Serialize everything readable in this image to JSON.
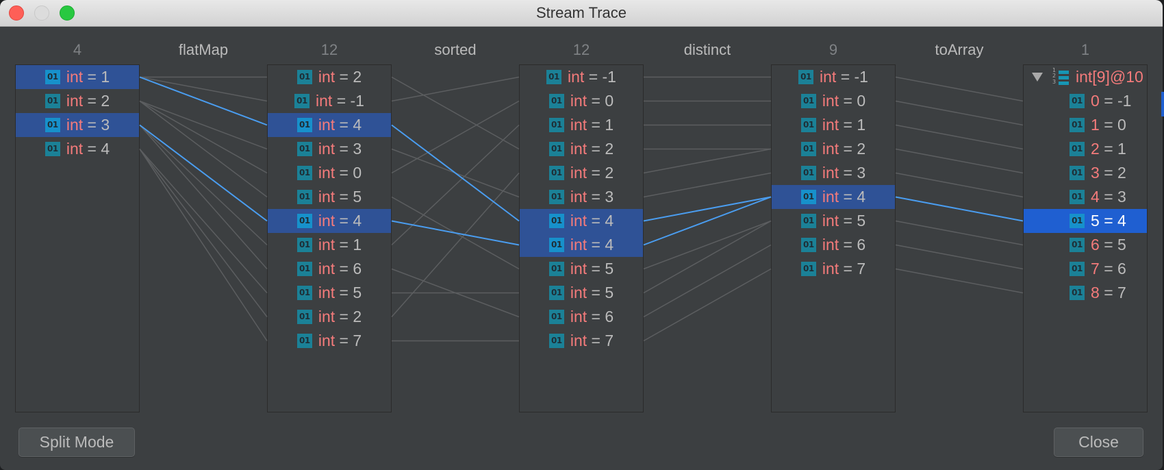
{
  "window": {
    "title": "Stream Trace"
  },
  "colors": {
    "selected_row": "#2f5296",
    "selected_row_focused": "#1f5fd1",
    "link_default": "#5c5e60",
    "link_selected": "#4a9df0",
    "name_text": "#f47b7b",
    "value_text": "#bbbbbb"
  },
  "stages": [
    {
      "count": "4"
    },
    {
      "count": "12"
    },
    {
      "count": "12"
    },
    {
      "count": "9"
    },
    {
      "count": "1"
    }
  ],
  "operations": [
    "flatMap",
    "sorted",
    "distinct",
    "toArray"
  ],
  "columns": [
    {
      "items": [
        {
          "name": "int",
          "value": "= 1",
          "selected": true
        },
        {
          "name": "int",
          "value": "= 2",
          "selected": false
        },
        {
          "name": "int",
          "value": "= 3",
          "selected": true
        },
        {
          "name": "int",
          "value": "= 4",
          "selected": false
        }
      ]
    },
    {
      "items": [
        {
          "name": "int",
          "value": "= 2",
          "selected": false
        },
        {
          "name": "int",
          "value": "= -1",
          "selected": false
        },
        {
          "name": "int",
          "value": "= 4",
          "selected": true
        },
        {
          "name": "int",
          "value": "= 3",
          "selected": false
        },
        {
          "name": "int",
          "value": "= 0",
          "selected": false
        },
        {
          "name": "int",
          "value": "= 5",
          "selected": false
        },
        {
          "name": "int",
          "value": "= 4",
          "selected": true
        },
        {
          "name": "int",
          "value": "= 1",
          "selected": false
        },
        {
          "name": "int",
          "value": "= 6",
          "selected": false
        },
        {
          "name": "int",
          "value": "= 5",
          "selected": false
        },
        {
          "name": "int",
          "value": "= 2",
          "selected": false
        },
        {
          "name": "int",
          "value": "= 7",
          "selected": false
        }
      ]
    },
    {
      "items": [
        {
          "name": "int",
          "value": "= -1",
          "selected": false
        },
        {
          "name": "int",
          "value": "= 0",
          "selected": false
        },
        {
          "name": "int",
          "value": "= 1",
          "selected": false
        },
        {
          "name": "int",
          "value": "= 2",
          "selected": false
        },
        {
          "name": "int",
          "value": "= 2",
          "selected": false
        },
        {
          "name": "int",
          "value": "= 3",
          "selected": false
        },
        {
          "name": "int",
          "value": "= 4",
          "selected": true
        },
        {
          "name": "int",
          "value": "= 4",
          "selected": true
        },
        {
          "name": "int",
          "value": "= 5",
          "selected": false
        },
        {
          "name": "int",
          "value": "= 5",
          "selected": false
        },
        {
          "name": "int",
          "value": "= 6",
          "selected": false
        },
        {
          "name": "int",
          "value": "= 7",
          "selected": false
        }
      ]
    },
    {
      "items": [
        {
          "name": "int",
          "value": "= -1",
          "selected": false
        },
        {
          "name": "int",
          "value": "= 0",
          "selected": false
        },
        {
          "name": "int",
          "value": "= 1",
          "selected": false
        },
        {
          "name": "int",
          "value": "= 2",
          "selected": false
        },
        {
          "name": "int",
          "value": "= 3",
          "selected": false
        },
        {
          "name": "int",
          "value": "= 4",
          "selected": true
        },
        {
          "name": "int",
          "value": "= 5",
          "selected": false
        },
        {
          "name": "int",
          "value": "= 6",
          "selected": false
        },
        {
          "name": "int",
          "value": "= 7",
          "selected": false
        }
      ]
    }
  ],
  "result": {
    "label": "int[9]@10",
    "expanded": true,
    "array_icon_digits": [
      "1",
      "2",
      "3"
    ],
    "items": [
      {
        "name": "0",
        "value": "= -1",
        "selected": false
      },
      {
        "name": "1",
        "value": "= 0",
        "selected": false
      },
      {
        "name": "2",
        "value": "= 1",
        "selected": false
      },
      {
        "name": "3",
        "value": "= 2",
        "selected": false
      },
      {
        "name": "4",
        "value": "= 3",
        "selected": false
      },
      {
        "name": "5",
        "value": "= 4",
        "selected": true
      },
      {
        "name": "6",
        "value": "= 5",
        "selected": false
      },
      {
        "name": "7",
        "value": "= 6",
        "selected": false
      },
      {
        "name": "8",
        "value": "= 7",
        "selected": false
      }
    ]
  },
  "links": [
    [
      [
        0,
        0
      ],
      [
        0,
        1
      ],
      [
        0,
        2
      ],
      [
        1,
        3
      ],
      [
        1,
        4
      ],
      [
        1,
        5
      ],
      [
        2,
        6
      ],
      [
        2,
        7
      ],
      [
        2,
        8
      ],
      [
        3,
        9
      ],
      [
        3,
        10
      ],
      [
        3,
        11
      ]
    ],
    [
      [
        0,
        3
      ],
      [
        1,
        0
      ],
      [
        2,
        6
      ],
      [
        3,
        5
      ],
      [
        4,
        1
      ],
      [
        5,
        8
      ],
      [
        6,
        7
      ],
      [
        7,
        2
      ],
      [
        8,
        10
      ],
      [
        9,
        9
      ],
      [
        10,
        4
      ],
      [
        11,
        11
      ]
    ],
    [
      [
        0,
        0
      ],
      [
        1,
        1
      ],
      [
        2,
        2
      ],
      [
        3,
        3
      ],
      [
        4,
        3
      ],
      [
        5,
        4
      ],
      [
        6,
        5
      ],
      [
        7,
        5
      ],
      [
        8,
        6
      ],
      [
        9,
        6
      ],
      [
        10,
        7
      ],
      [
        11,
        8
      ]
    ],
    [
      [
        0,
        1
      ],
      [
        1,
        2
      ],
      [
        2,
        3
      ],
      [
        3,
        4
      ],
      [
        4,
        5
      ],
      [
        5,
        6
      ],
      [
        6,
        7
      ],
      [
        7,
        8
      ],
      [
        8,
        9
      ]
    ]
  ],
  "selected_links": [
    [
      [
        0,
        2
      ],
      [
        2,
        6
      ]
    ],
    [
      [
        2,
        6
      ],
      [
        6,
        7
      ]
    ],
    [
      [
        6,
        5
      ],
      [
        7,
        5
      ]
    ],
    [
      [
        5,
        6
      ]
    ]
  ],
  "buttons": {
    "split_mode": "Split Mode",
    "close": "Close"
  }
}
